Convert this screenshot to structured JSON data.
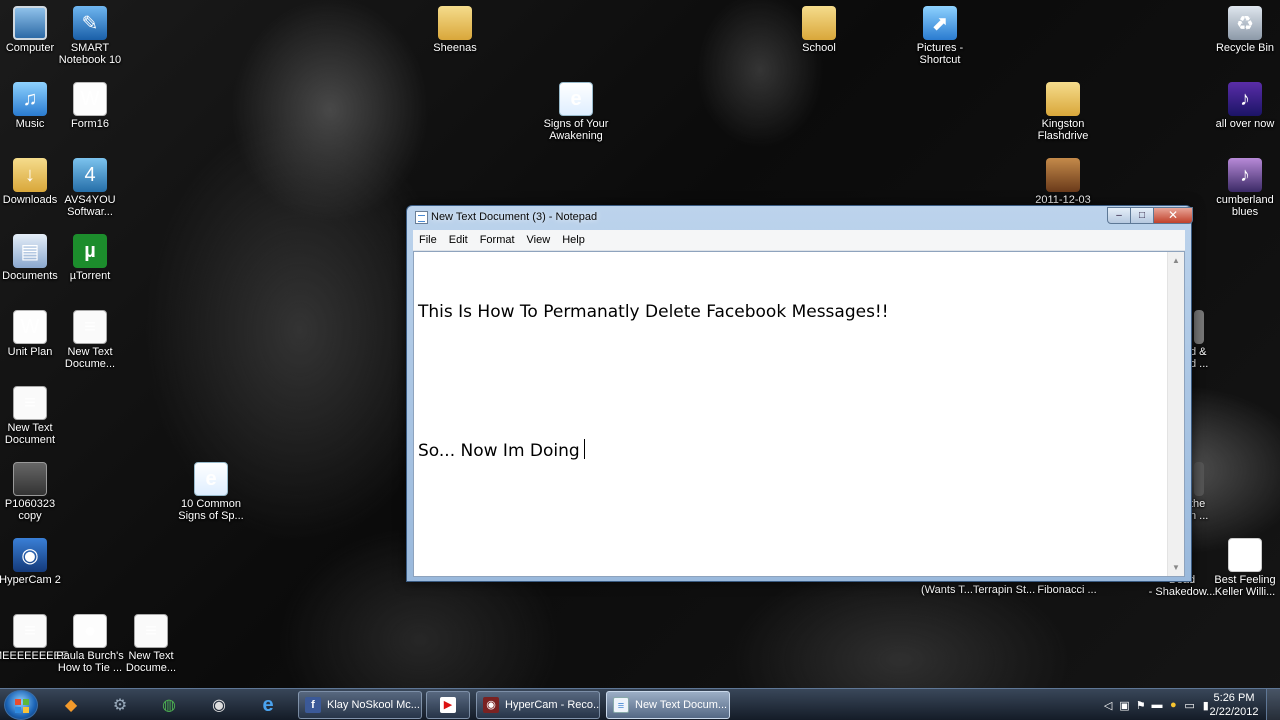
{
  "desktop": {
    "icons": [
      {
        "label": "Computer",
        "icon": "computer-icon"
      },
      {
        "label": "SMART\nNotebook 10",
        "icon": "smart-notebook-icon"
      },
      {
        "label": "Sheenas",
        "icon": "folder-icon"
      },
      {
        "label": "School",
        "icon": "folder-icon"
      },
      {
        "label": "Pictures -\nShortcut",
        "icon": "pictures-shortcut-icon"
      },
      {
        "label": "Recycle Bin",
        "icon": "recycle-bin-icon"
      },
      {
        "label": "Music",
        "icon": "music-icon"
      },
      {
        "label": "Form16",
        "icon": "word-document-icon"
      },
      {
        "label": "Signs of Your\nAwakening",
        "icon": "internet-explorer-icon"
      },
      {
        "label": "Kingston\nFlashdrive",
        "icon": "folder-icon"
      },
      {
        "label": "all over now",
        "icon": "media-file-icon"
      },
      {
        "label": "Downloads",
        "icon": "downloads-folder-icon"
      },
      {
        "label": "AVS4YOU\nSoftwar...",
        "icon": "avs4you-icon"
      },
      {
        "label": "2011-12-03",
        "icon": "folder-icon"
      },
      {
        "label": "cumberland\nblues",
        "icon": "media-file-icon"
      },
      {
        "label": "Documents",
        "icon": "documents-icon"
      },
      {
        "label": "µTorrent",
        "icon": "utorrent-icon"
      },
      {
        "label": "Unit Plan",
        "icon": "word-document-icon"
      },
      {
        "label": "New Text\nDocume...",
        "icon": "text-document-icon"
      },
      {
        "label": "New Text\nDocument",
        "icon": "text-document-icon"
      },
      {
        "label": "P1060323\ncopy",
        "icon": "photo-icon"
      },
      {
        "label": "10 Common\nSigns of Sp...",
        "icon": "internet-explorer-icon"
      },
      {
        "label": "HyperCam 2",
        "icon": "hypercam-icon"
      },
      {
        "label": "MEEEEEEEEE",
        "icon": "text-document-icon"
      },
      {
        "label": "Paula Burch's\nHow to Tie ...",
        "icon": "web-page-icon"
      },
      {
        "label": "New Text\nDocume...",
        "icon": "text-document-icon"
      },
      {
        "label": "Best Feeling\nKeller Willi...",
        "icon": "youtube-icon"
      },
      {
        "label": "d &\nd ...",
        "icon": "media-file-icon"
      },
      {
        "label": "the\nn ...",
        "icon": "media-file-icon"
      },
      {
        "label": "(Wants T...",
        "icon": "media-file-icon"
      },
      {
        "label": "Terrapin St...",
        "icon": "media-file-icon"
      },
      {
        "label": "Fibonacci ...",
        "icon": "media-file-icon"
      },
      {
        "label": "Dead\n- Shakedow...",
        "icon": "media-file-icon"
      }
    ]
  },
  "notepad": {
    "title": "New Text Document (3) - Notepad",
    "controls": {
      "minimize": "–",
      "maximize": "□",
      "close": "✕"
    },
    "menu": [
      "File",
      "Edit",
      "Format",
      "View",
      "Help"
    ],
    "lines": [
      "This Is How To Permanatly Delete Facebook Messages!!",
      "",
      "So... Now Im Doing"
    ]
  },
  "taskbar": {
    "pinned": [
      "media-player-icon",
      "settings-icon",
      "chrome-icon",
      "camera-icon",
      "internet-explorer-icon"
    ],
    "tasks": [
      {
        "label": "Klay NoSkool Mc...",
        "icon": "facebook-icon",
        "active": false
      },
      {
        "label": "",
        "icon": "youtube-icon",
        "active": false
      },
      {
        "label": "HyperCam - Reco...",
        "icon": "hypercam-icon",
        "active": false
      },
      {
        "label": "New Text Docum...",
        "icon": "notepad-icon",
        "active": true
      }
    ],
    "clock": {
      "time": "5:26 PM",
      "date": "2/22/2012"
    }
  },
  "colors": {
    "window_frame": "#9ab9dc",
    "taskbar": "#1e2a3a",
    "text": "#000000"
  }
}
